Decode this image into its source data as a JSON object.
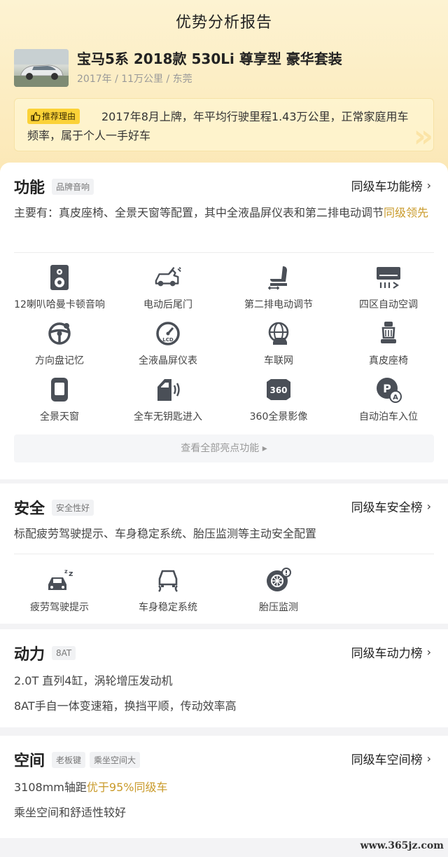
{
  "header": {
    "title": "优势分析报告",
    "car_name": "宝马5系 2018款 530Li 尊享型 豪华套装",
    "car_meta": "2017年 / 11万公里 / 东莞"
  },
  "reason": {
    "tag": "推荐理由",
    "text": "2017年8月上牌，年平均行驶里程1.43万公里，正常家庭用车频率，属于个人一手好车"
  },
  "function": {
    "title": "功能",
    "tag": "品牌音响",
    "link": "同级车功能榜",
    "desc_main": "主要有：真皮座椅、全景天窗等配置，其中全液晶屏仪表和第二排电动调节",
    "desc_highlight": "同级领先",
    "features": [
      {
        "label": "12喇叭哈曼卡顿音响",
        "icon": "speaker-icon"
      },
      {
        "label": "电动后尾门",
        "icon": "power-tailgate-icon"
      },
      {
        "label": "第二排电动调节",
        "icon": "seat-adjust-icon"
      },
      {
        "label": "四区自动空调",
        "icon": "air-conditioner-icon"
      },
      {
        "label": "方向盘记忆",
        "icon": "steering-wheel-icon"
      },
      {
        "label": "全液晶屏仪表",
        "icon": "lcd-gauge-icon"
      },
      {
        "label": "车联网",
        "icon": "connected-car-icon"
      },
      {
        "label": "真皮座椅",
        "icon": "leather-seat-icon"
      },
      {
        "label": "全景天窗",
        "icon": "sunroof-icon"
      },
      {
        "label": "全车无钥匙进入",
        "icon": "keyless-entry-icon"
      },
      {
        "label": "360全景影像",
        "icon": "camera-360-icon"
      },
      {
        "label": "自动泊车入位",
        "icon": "auto-park-icon"
      }
    ],
    "more": "查看全部亮点功能 ▸"
  },
  "safety": {
    "title": "安全",
    "tag": "安全性好",
    "link": "同级车安全榜",
    "desc": "标配疲劳驾驶提示、车身稳定系统、胎压监测等主动安全配置",
    "features": [
      {
        "label": "疲劳驾驶提示",
        "icon": "fatigue-alert-icon"
      },
      {
        "label": "车身稳定系统",
        "icon": "stability-control-icon"
      },
      {
        "label": "胎压监测",
        "icon": "tire-pressure-icon"
      }
    ]
  },
  "power": {
    "title": "动力",
    "tag": "8AT",
    "link": "同级车动力榜",
    "line1": "2.0T 直列4缸，涡轮增压发动机",
    "line2": "8AT手自一体变速箱，换挡平顺，传动效率高"
  },
  "space": {
    "title": "空间",
    "tag1": "老板键",
    "tag2": "乘坐空间大",
    "link": "同级车空间榜",
    "line1_main": "3108mm轴距",
    "line1_highlight": "优于95%同级车",
    "line2": "乘坐空间和舒适性较好"
  },
  "chevron": "›",
  "watermark": "www.365jz.com",
  "colors": {
    "accent": "#fbd238",
    "highlight": "#c99a2a"
  }
}
